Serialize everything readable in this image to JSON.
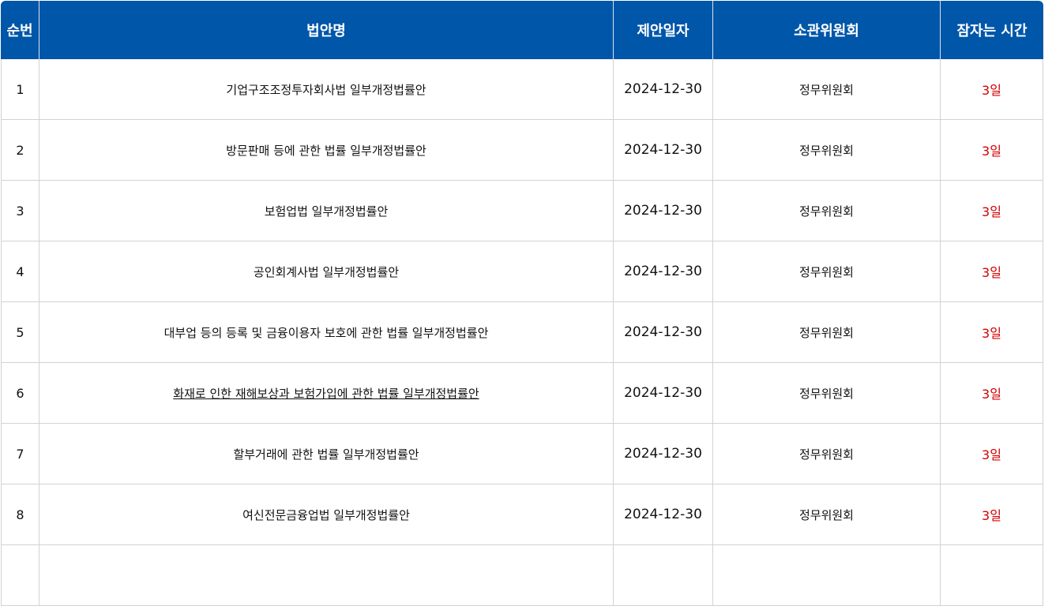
{
  "table": {
    "headers": {
      "number": "순번",
      "bill_name": "법안명",
      "proposal_date": "제안일자",
      "committee": "소관위원회",
      "remaining_time": "잠자는 시간"
    },
    "rows": [
      {
        "number": "1",
        "bill_name": "기업구조조정투자회사법 일부개정법률안",
        "proposal_date": "2024-12-30",
        "committee": "정무위원회",
        "remaining_time": "3일"
      },
      {
        "number": "2",
        "bill_name": "방문판매 등에 관한 법률 일부개정법률안",
        "proposal_date": "2024-12-30",
        "committee": "정무위원회",
        "remaining_time": "3일"
      },
      {
        "number": "3",
        "bill_name": "보험업법 일부개정법률안",
        "proposal_date": "2024-12-30",
        "committee": "정무위원회",
        "remaining_time": "3일"
      },
      {
        "number": "4",
        "bill_name": "공인회계사법 일부개정법률안",
        "proposal_date": "2024-12-30",
        "committee": "정무위원회",
        "remaining_time": "3일"
      },
      {
        "number": "5",
        "bill_name": "대부업 등의 등록 및 금융이용자 보호에 관한 법률 일부개정법률안",
        "proposal_date": "2024-12-30",
        "committee": "정무위원회",
        "remaining_time": "3일"
      },
      {
        "number": "6",
        "bill_name": "화재로 인한 재해보상과 보험가입에 관한 법률 일부개정법률안",
        "proposal_date": "2024-12-30",
        "committee": "정무위원회",
        "remaining_time": "3일"
      },
      {
        "number": "7",
        "bill_name": "할부거래에 관한 법률 일부개정법률안",
        "proposal_date": "2024-12-30",
        "committee": "정무위원회",
        "remaining_time": "3일"
      },
      {
        "number": "8",
        "bill_name": "여신전문금융업법 일부개정법률안",
        "proposal_date": "2024-12-30",
        "committee": "정무위원회",
        "remaining_time": "3일"
      }
    ]
  },
  "colors": {
    "header_background": "#0056a8",
    "remaining_time_text": "#d40000",
    "grid_line": "#d2d2d2"
  }
}
